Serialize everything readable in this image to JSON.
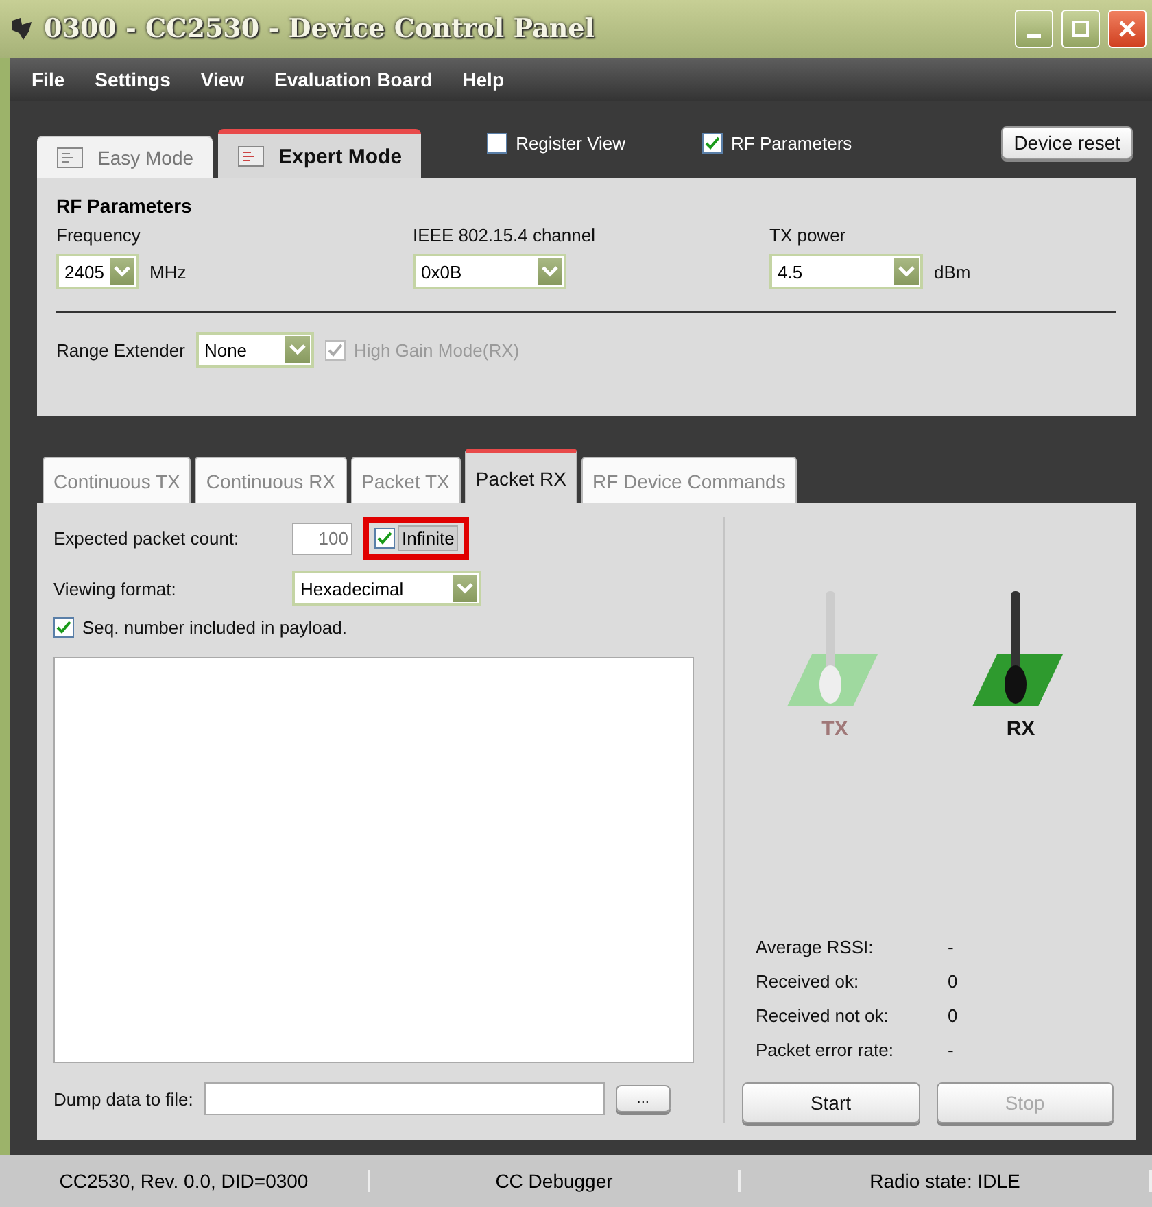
{
  "window": {
    "title": "0300 - CC2530 - Device Control Panel"
  },
  "menu": [
    "File",
    "Settings",
    "View",
    "Evaluation Board",
    "Help"
  ],
  "mode_tabs": [
    {
      "label": "Easy Mode",
      "selected": false
    },
    {
      "label": "Expert Mode",
      "selected": true
    }
  ],
  "top_options": [
    {
      "label": "Register View",
      "checked": false
    },
    {
      "label": "RF Parameters",
      "checked": true
    }
  ],
  "device_reset": "Device reset",
  "rf_parameters": {
    "title": "RF Parameters",
    "fields": [
      {
        "label": "Frequency",
        "value": "2405",
        "unit": "MHz"
      },
      {
        "label": "IEEE 802.15.4 channel",
        "value": "0x0B"
      },
      {
        "label": "TX power",
        "value": "4.5",
        "unit": "dBm"
      }
    ],
    "range_extender": {
      "label": "Range Extender",
      "value": "None"
    },
    "high_gain": {
      "label": "High Gain Mode(RX)",
      "checked": true,
      "disabled": true
    }
  },
  "test_tabs": [
    {
      "label": "Continuous TX",
      "selected": false
    },
    {
      "label": "Continuous RX",
      "selected": false
    },
    {
      "label": "Packet TX",
      "selected": false
    },
    {
      "label": "Packet RX",
      "selected": true
    },
    {
      "label": "RF Device Commands",
      "selected": false
    }
  ],
  "packet_rx": {
    "expected_count": {
      "label": "Expected packet count:",
      "value": "100",
      "disabled": true
    },
    "infinite": {
      "label": "Infinite",
      "checked": true,
      "highlighted": true
    },
    "viewing_format": {
      "label": "Viewing format:",
      "value": "Hexadecimal"
    },
    "seq_number": {
      "label": "Seq. number included in payload.",
      "checked": true
    },
    "dump": {
      "label": "Dump data to file:",
      "browse": "..."
    },
    "switches": [
      {
        "label": "TX",
        "active": false
      },
      {
        "label": "RX",
        "active": true
      }
    ],
    "stats": [
      {
        "label": "Average RSSI:",
        "value": "-"
      },
      {
        "label": "Received ok:",
        "value": "0"
      },
      {
        "label": "Received not ok:",
        "value": "0"
      },
      {
        "label": "Packet error rate:",
        "value": "-"
      }
    ],
    "buttons": [
      {
        "label": "Start",
        "disabled": false
      },
      {
        "label": "Stop",
        "disabled": true
      }
    ]
  },
  "status_bar": [
    "CC2530, Rev. 0.0, DID=0300",
    "CC Debugger",
    "Radio state: IDLE"
  ]
}
